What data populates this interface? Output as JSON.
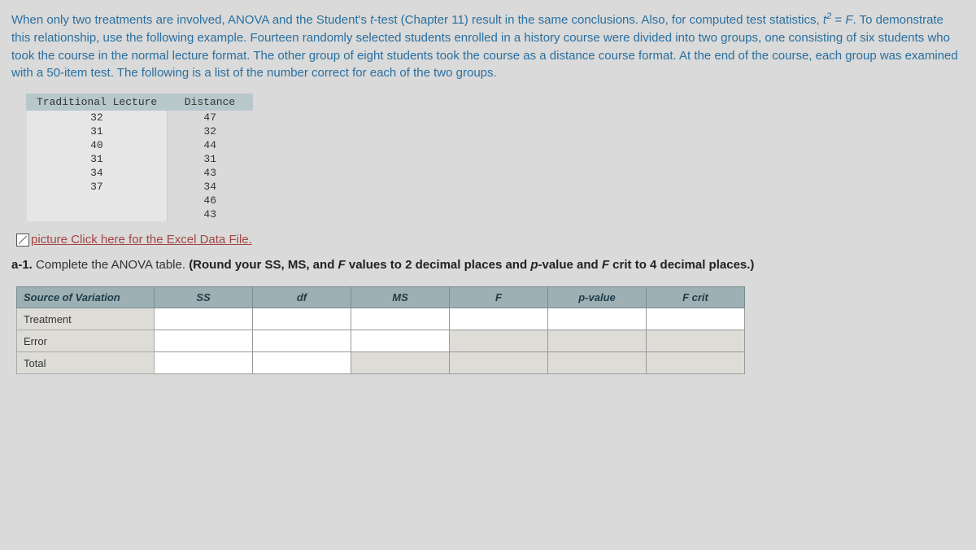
{
  "problem": {
    "p1": "When only two treatments are involved, ANOVA and the Student's ",
    "p1_t": "t",
    "p1b": "-test (Chapter 11) result in the same conclusions. Also, for computed test statistics, ",
    "p1_tsq": "t",
    "p1_sup": "2",
    "p1_eq": " = ",
    "p1_F": "F",
    "p2": ". To demonstrate this relationship, use the following example. Fourteen randomly selected students enrolled in a history course were divided into two groups, one consisting of six students who took the course in the normal lecture format. The other group of eight students took the course as a distance course format. At the end of the course, each group was examined with a 50-item test. The following is a list of the number correct for each of the two groups."
  },
  "data_table": {
    "headers": [
      "Traditional Lecture",
      "Distance"
    ],
    "rows": [
      [
        "32",
        "47"
      ],
      [
        "31",
        "32"
      ],
      [
        "40",
        "44"
      ],
      [
        "31",
        "31"
      ],
      [
        "34",
        "43"
      ],
      [
        "37",
        "34"
      ],
      [
        "",
        "46"
      ],
      [
        "",
        "43"
      ]
    ]
  },
  "link": {
    "prefix": "picture",
    "text": " Click here for the Excel Data File."
  },
  "question": {
    "label": "a-1.",
    "text": " Complete the ANOVA table. ",
    "hint_open": "(Round your SS, MS, and ",
    "hint_F": "F",
    "hint_mid": " values to 2 decimal places and ",
    "hint_p": "p",
    "hint_mid2": "-value and ",
    "hint_Fc": "F",
    "hint_close": " crit to 4 decimal places.)"
  },
  "anova": {
    "headers": [
      "Source of Variation",
      "SS",
      "df",
      "MS",
      "F",
      "p-value",
      "F crit"
    ],
    "row_labels": [
      "Treatment",
      "Error",
      "Total"
    ]
  }
}
